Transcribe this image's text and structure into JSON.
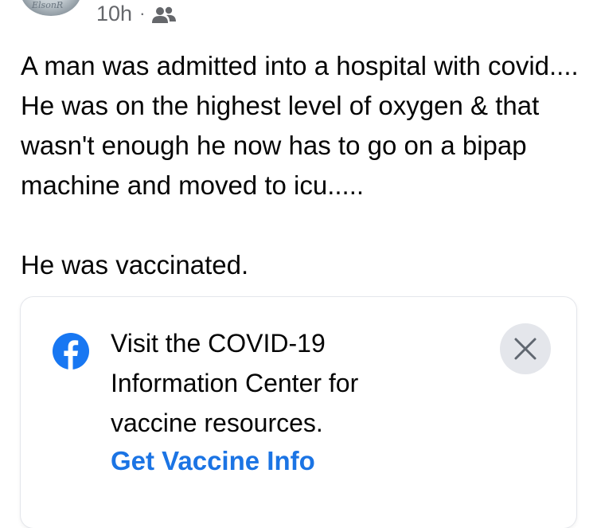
{
  "post": {
    "author_avatar_signature": "ElsonR",
    "timestamp": "10h",
    "separator": "·",
    "audience_icon": "friends-icon",
    "text": "A man was admitted into a hospital with covid.... He was on the highest level of oxygen & that wasn't enough he now has to go on a bipap machine and moved to icu.....\n\nHe was vaccinated."
  },
  "info_card": {
    "icon": "facebook-icon",
    "message": "Visit the COVID-19 Information Center for vaccine resources.",
    "link_label": "Get Vaccine Info",
    "close_icon": "close-icon"
  },
  "colors": {
    "text_primary": "#050505",
    "text_secondary": "#65676b",
    "link_blue": "#1b74e4",
    "close_bg": "#e4e6eb",
    "facebook_blue": "#1877f2"
  }
}
